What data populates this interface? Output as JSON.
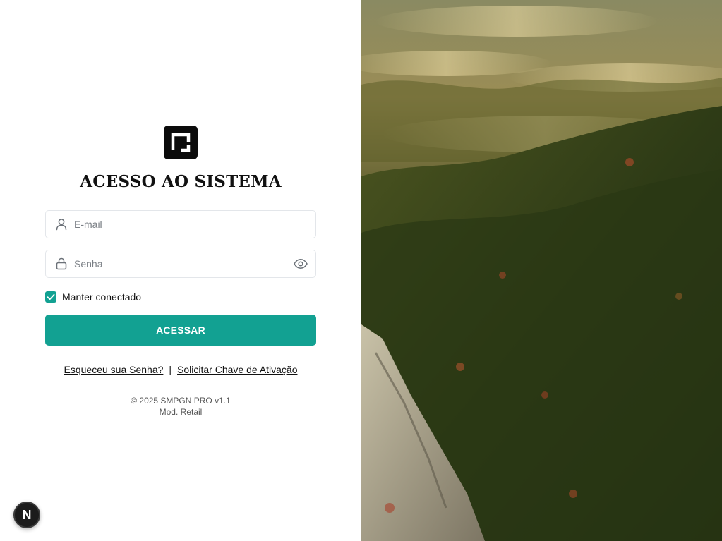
{
  "login": {
    "title": "ACESSO AO SISTEMA",
    "email_placeholder": "E-mail",
    "password_placeholder": "Senha",
    "remember_label": "Manter conectado",
    "remember_checked": true,
    "submit_label": "ACESSAR",
    "forgot_link": "Esqueceu sua Senha?",
    "separator": "|",
    "activation_link": "Solicitar Chave de Ativação"
  },
  "footer": {
    "copyright": "© 2025 SMPGN PRO v1.1",
    "module": "Mod. Retail"
  },
  "badge": {
    "label": "N"
  },
  "icons": {
    "logo": "logo-icon",
    "email": "user-icon",
    "password": "lock-icon",
    "toggle_password": "eye-icon",
    "checkbox": "check-icon"
  },
  "colors": {
    "accent": "#12a192",
    "logo_bg": "#0b0b0b",
    "field_border": "#e3e6ea"
  },
  "hero_image": {
    "description_name": "forest-mountain-photo"
  }
}
